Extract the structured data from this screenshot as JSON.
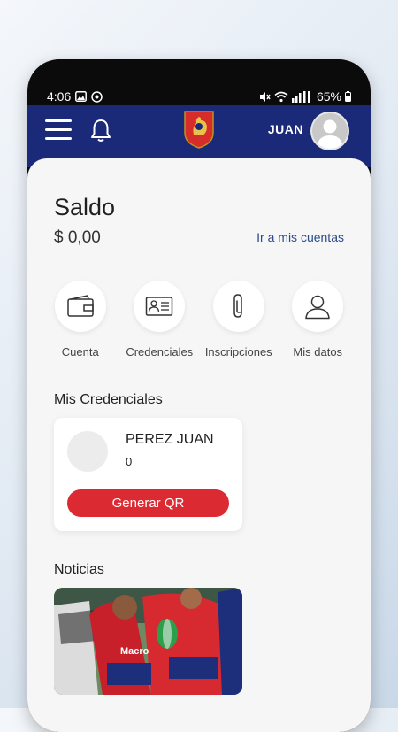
{
  "status_bar": {
    "time": "4:06",
    "battery": "65%"
  },
  "app_bar": {
    "user_name": "JUAN",
    "icons": [
      "menu-icon",
      "bell-icon",
      "club-crest",
      "avatar"
    ]
  },
  "balance": {
    "title": "Saldo",
    "amount": "$ 0,00",
    "link": "Ir a mis cuentas"
  },
  "actions": [
    {
      "label": "Cuenta",
      "icon": "wallet-icon"
    },
    {
      "label": "Credenciales",
      "icon": "id-card-icon"
    },
    {
      "label": "Inscripciones",
      "icon": "paperclip-icon"
    },
    {
      "label": "Mis datos",
      "icon": "user-icon"
    }
  ],
  "credentials": {
    "section_title": "Mis Credenciales",
    "name": "PEREZ JUAN",
    "number": "0",
    "button": "Generar QR"
  },
  "news": {
    "section_title": "Noticias",
    "image_text": "Macro"
  },
  "colors": {
    "brand_navy": "#1a2a78",
    "accent_red": "#dc2a33",
    "link_blue": "#2a4a8a"
  }
}
